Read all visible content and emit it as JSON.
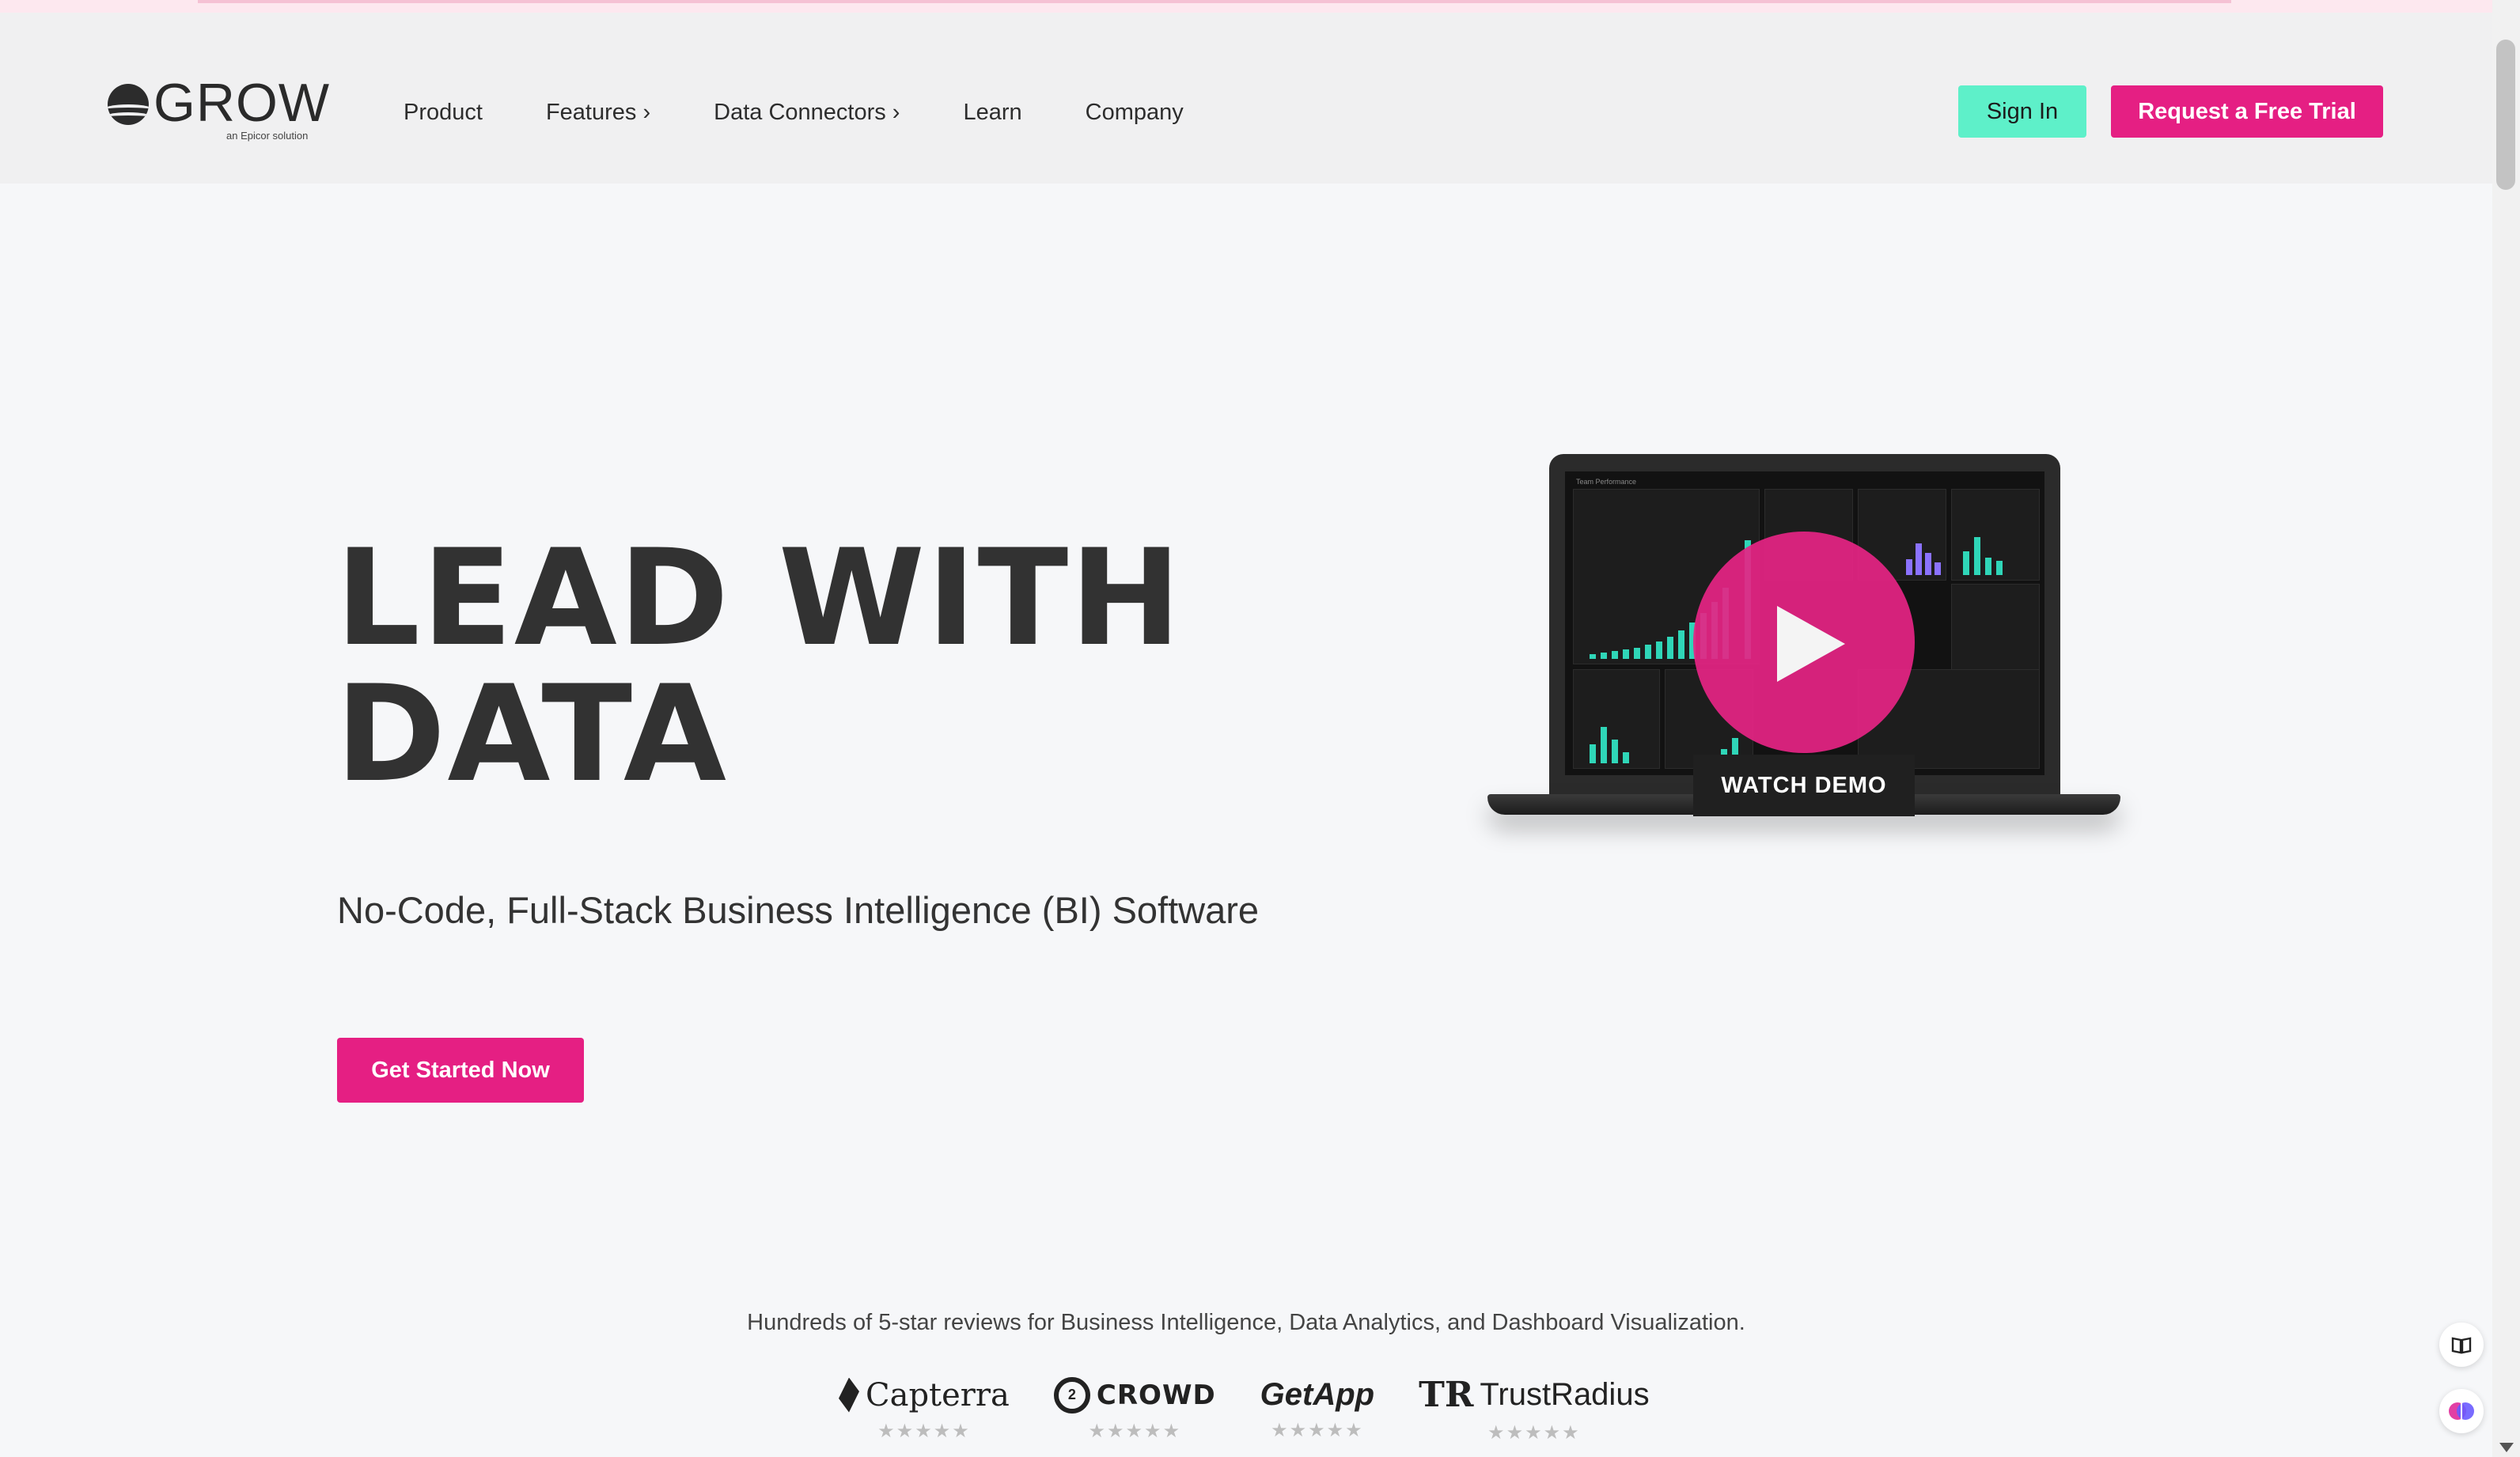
{
  "header": {
    "logo_text": "GROW",
    "logo_sub": "an Epicor solution",
    "nav": [
      {
        "label": "Product"
      },
      {
        "label": "Features ›"
      },
      {
        "label": "Data Connectors ›"
      },
      {
        "label": "Learn"
      },
      {
        "label": "Company"
      }
    ],
    "sign_in": "Sign In",
    "trial": "Request a Free Trial"
  },
  "hero": {
    "title_line1": "LEAD WITH",
    "title_line2": "DATA",
    "subtitle": "No-Code, Full-Stack Business Intelligence (BI) Software",
    "cta": "Get Started Now",
    "demo_label": "WATCH DEMO",
    "dashboard_title": "Team Performance"
  },
  "reviews": {
    "text": "Hundreds of 5-star reviews for Business Intelligence, Data Analytics, and Dashboard Visualization.",
    "logos": [
      {
        "name": "Capterra",
        "icon": "capterra-icon"
      },
      {
        "name": "CROWD",
        "icon": "g2-icon"
      },
      {
        "name": "GetApp",
        "icon": "getapp-icon"
      },
      {
        "name": "TrustRadius",
        "icon": "trustradius-icon"
      }
    ],
    "stars": "★★★★★"
  },
  "colors": {
    "accent": "#e51f83",
    "signin": "#5ef0c9",
    "background": "#f6f7f9"
  }
}
